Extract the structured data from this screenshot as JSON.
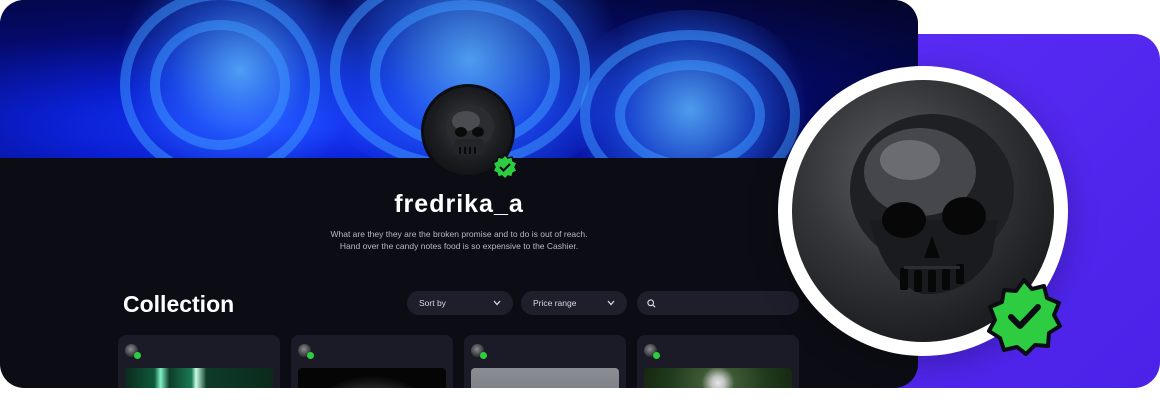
{
  "profile": {
    "username": "fredrika_a",
    "bio_line1": "What are they they are the broken promise and to do is out of reach.",
    "bio_line2": "Hand over the candy notes food is so expensive to the Cashier.",
    "verified": true
  },
  "collection": {
    "title": "Collection",
    "sort_label": "Sort by",
    "price_label": "Price range",
    "search_value": "",
    "search_placeholder": ""
  },
  "cards": [
    {
      "image": "green-light-streaks"
    },
    {
      "image": "stone-sculpture"
    },
    {
      "image": "grey-abstract"
    },
    {
      "image": "astronaut-in-forest"
    }
  ],
  "colors": {
    "accent_purple": "#4a22e8",
    "verified_green": "#2ecc40",
    "background": "#0c0d14",
    "control_bg": "#1d1f2b"
  },
  "icons": {
    "verified": "verified-badge-icon",
    "chevron": "chevron-down-icon",
    "search": "search-icon"
  }
}
